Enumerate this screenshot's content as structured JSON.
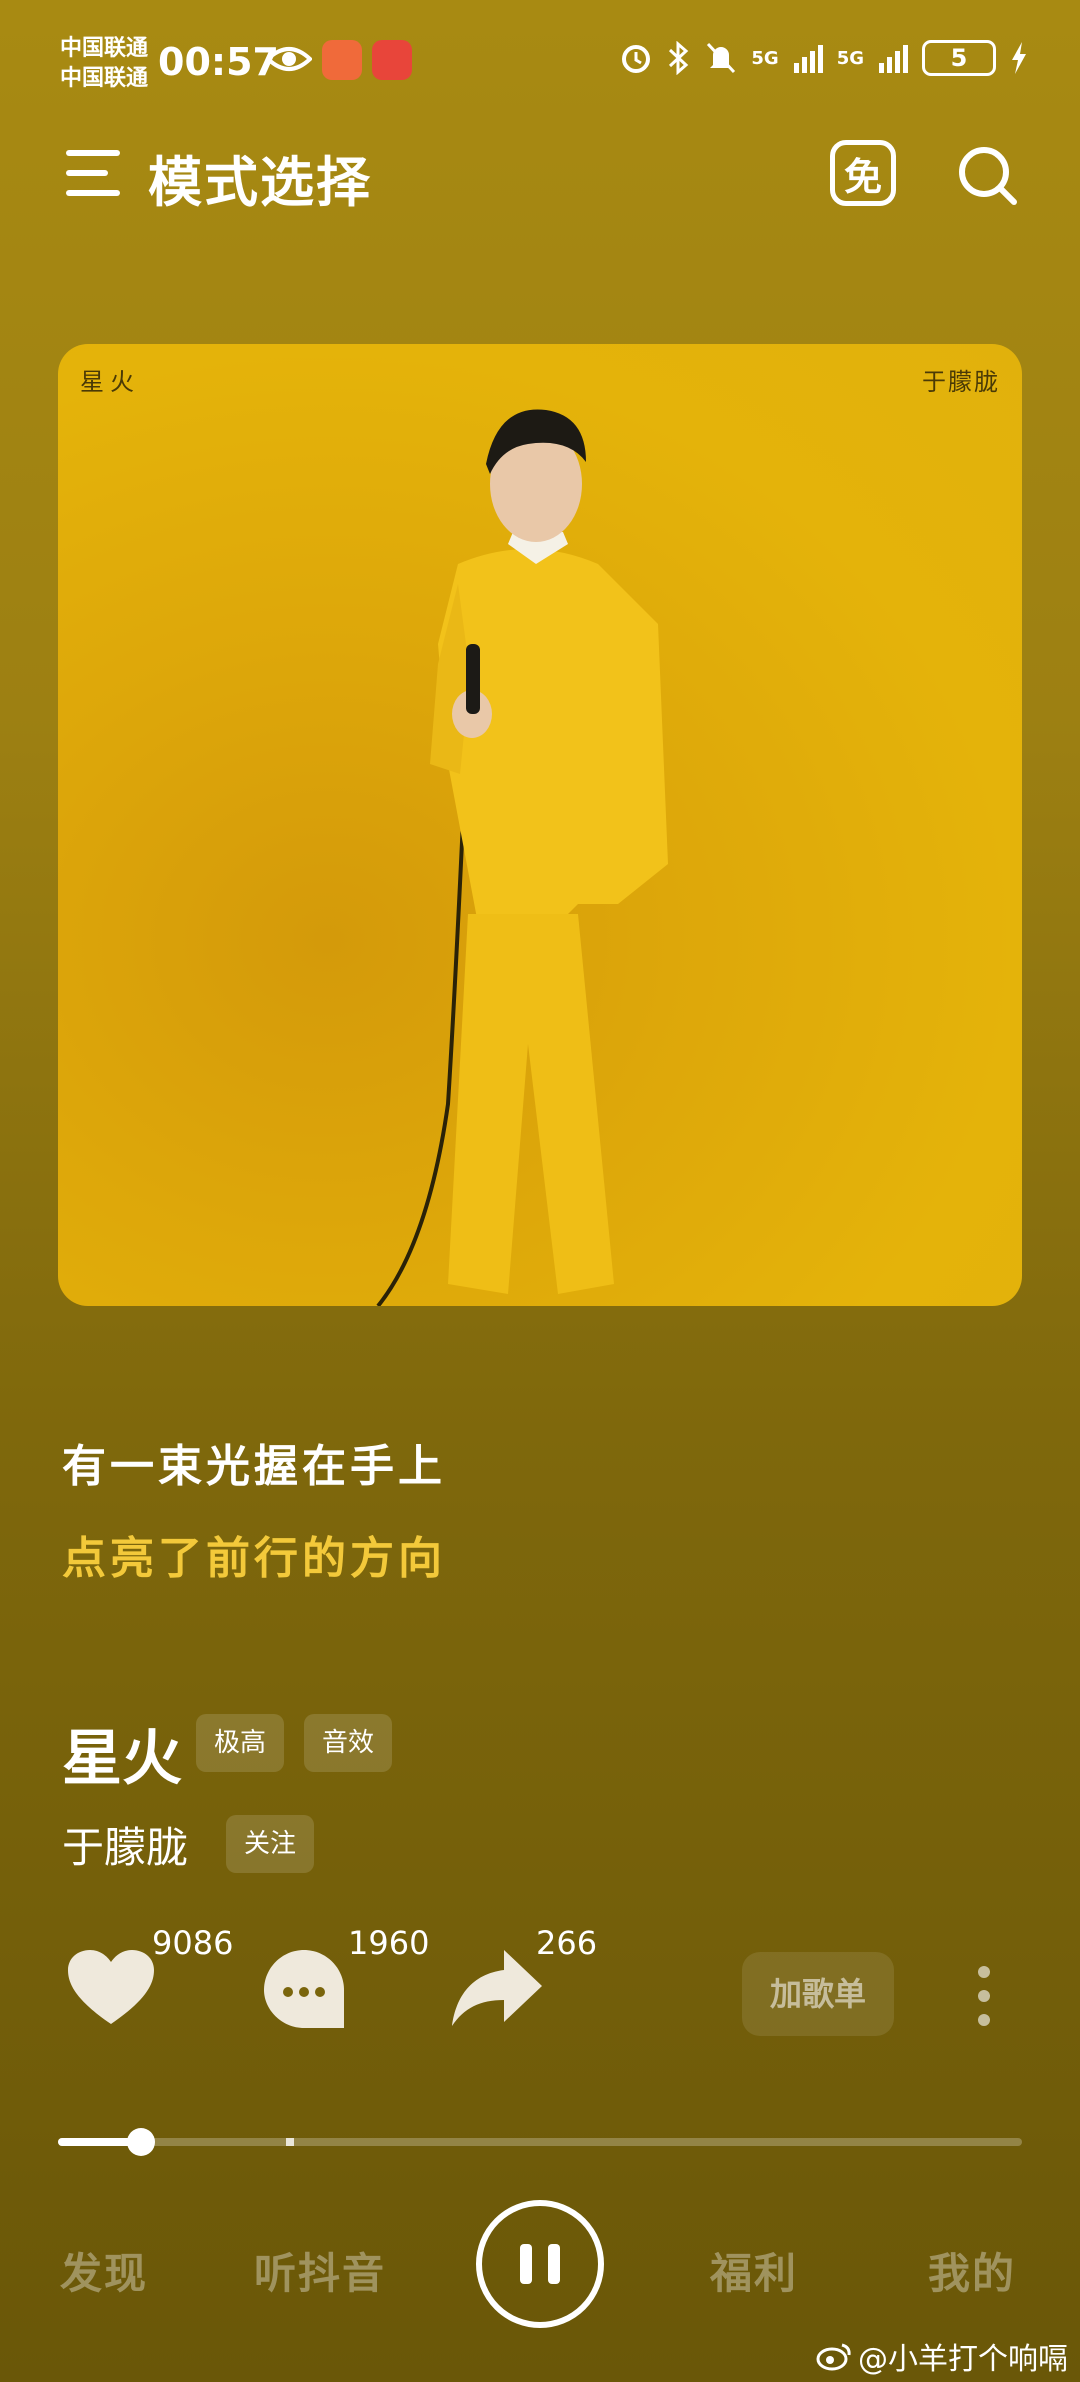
{
  "status_bar": {
    "carrier_1": "中国联通",
    "carrier_2": "中国联通",
    "time": "00:57",
    "network_1": "5G",
    "network_2": "5G",
    "battery": "5"
  },
  "header": {
    "title": "模式选择",
    "free_badge": "免"
  },
  "cover": {
    "song_label": "星火",
    "artist_label": "于朦胧"
  },
  "lyrics": {
    "line_1": "有一束光握在手上",
    "line_2": "点亮了前行的方向"
  },
  "song": {
    "title": "星火",
    "quality_tag": "极高",
    "effect_tag": "音效",
    "artist": "于朦胧",
    "follow_label": "关注"
  },
  "actions": {
    "like_count": "9086",
    "comment_count": "1960",
    "share_count": "266",
    "add_playlist_label": "加歌单"
  },
  "progress": {
    "played_fraction": 0.086,
    "buffered_fraction": 0.236
  },
  "bottom_nav": {
    "discover": "发现",
    "douyin": "听抖音",
    "welfare": "福利",
    "mine": "我的"
  },
  "watermark": "@小羊打个响嗝",
  "colors": {
    "background": "#9d8012",
    "cover_bg": "#e1b10c",
    "lyric_highlight": "#f3c93a"
  }
}
